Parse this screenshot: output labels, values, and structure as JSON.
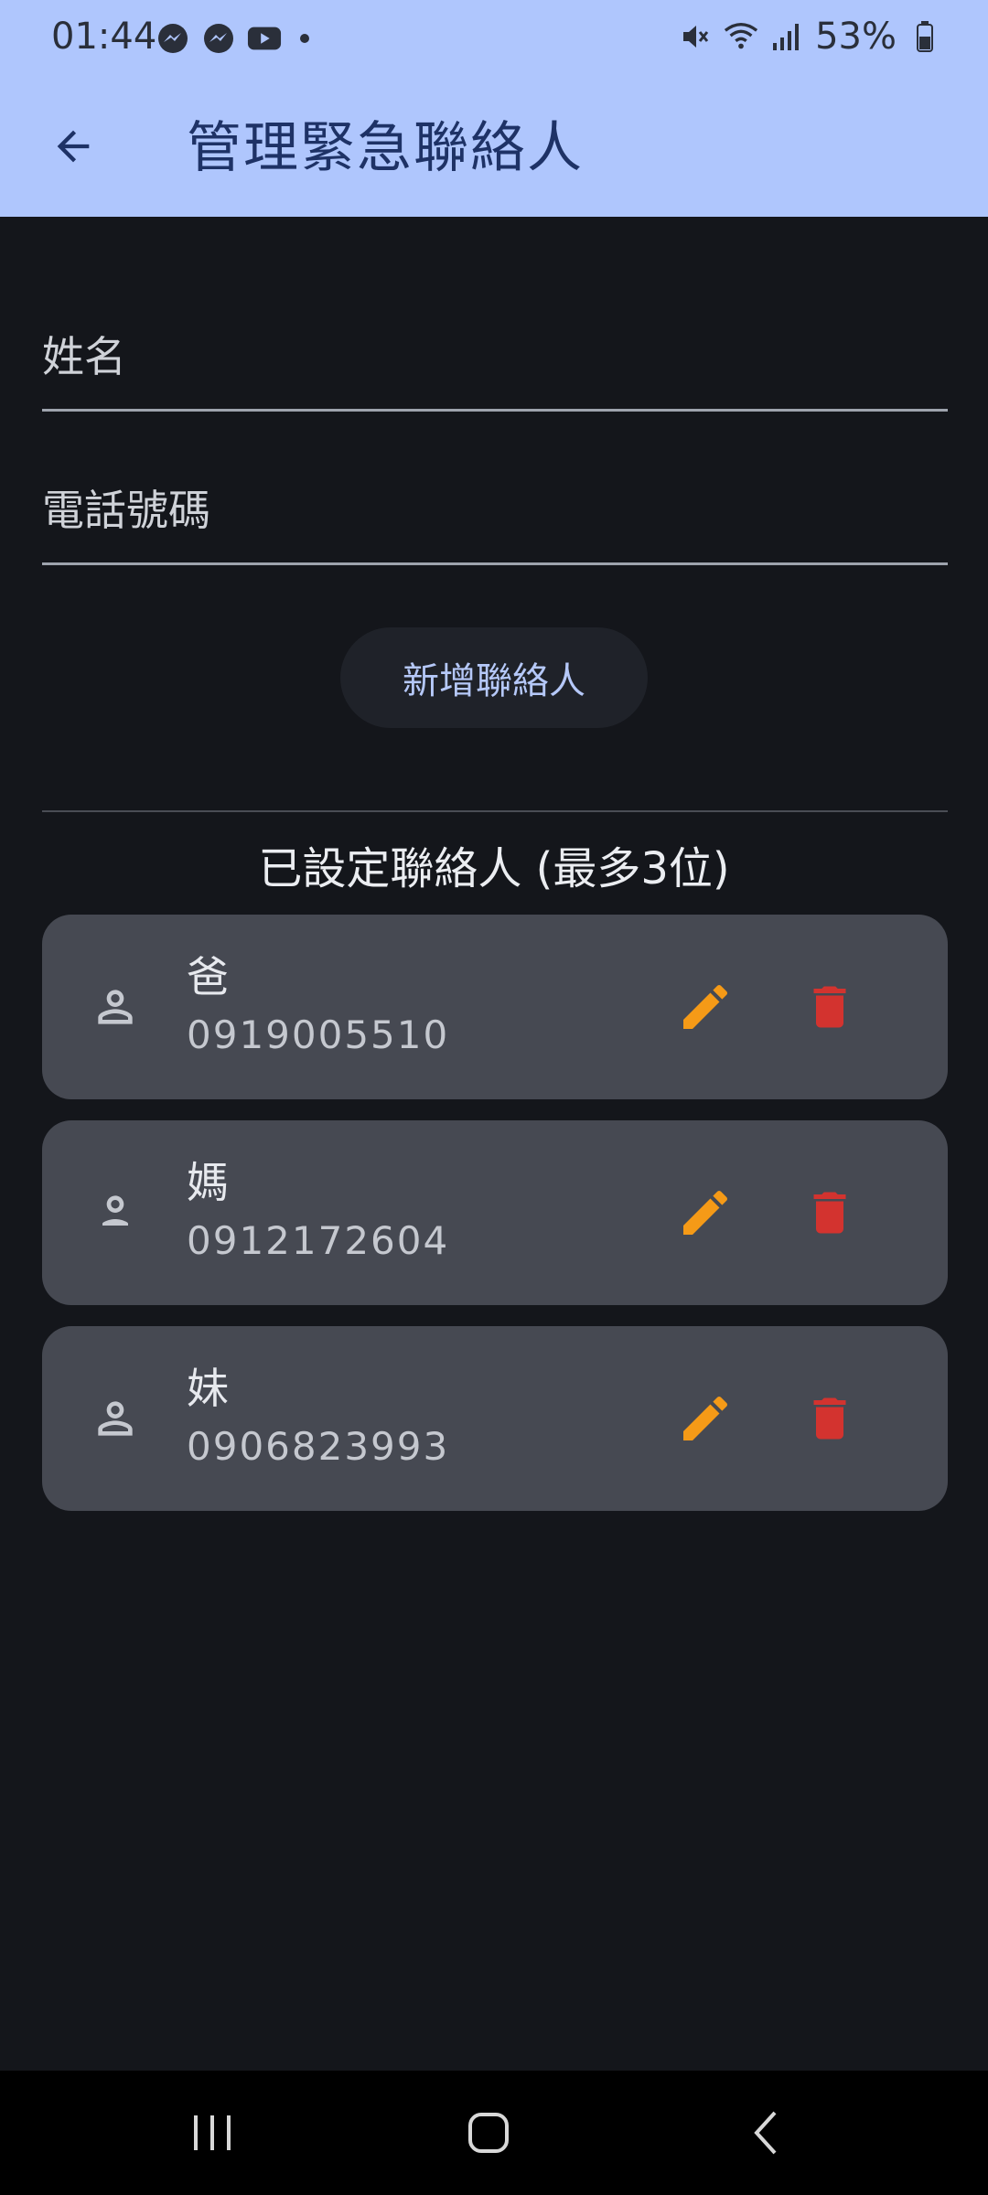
{
  "status_bar": {
    "time": "01:44",
    "left_icons": [
      "messenger-icon",
      "messenger-icon",
      "youtube-icon",
      "notification-dot"
    ],
    "right_icons": [
      "mute-icon",
      "wifi-icon",
      "signal-icon",
      "battery-icon"
    ],
    "battery": "53%"
  },
  "app_bar": {
    "title": "管理緊急聯絡人",
    "background": "#afc6fd",
    "title_color": "#1e3266"
  },
  "form": {
    "name_placeholder": "姓名",
    "name_value": "",
    "phone_placeholder": "電話號碼",
    "phone_value": "",
    "add_button_label": "新增聯絡人"
  },
  "section_title": "已設定聯絡人 (最多3位)",
  "contacts": [
    {
      "name": "爸",
      "phone": "0919005510"
    },
    {
      "name": "媽",
      "phone": "0912172604"
    },
    {
      "name": "妹",
      "phone": "0906823993"
    }
  ],
  "colors": {
    "background": "#14161b",
    "card": "#464952",
    "edit": "#f59a17",
    "delete": "#d3332f"
  }
}
